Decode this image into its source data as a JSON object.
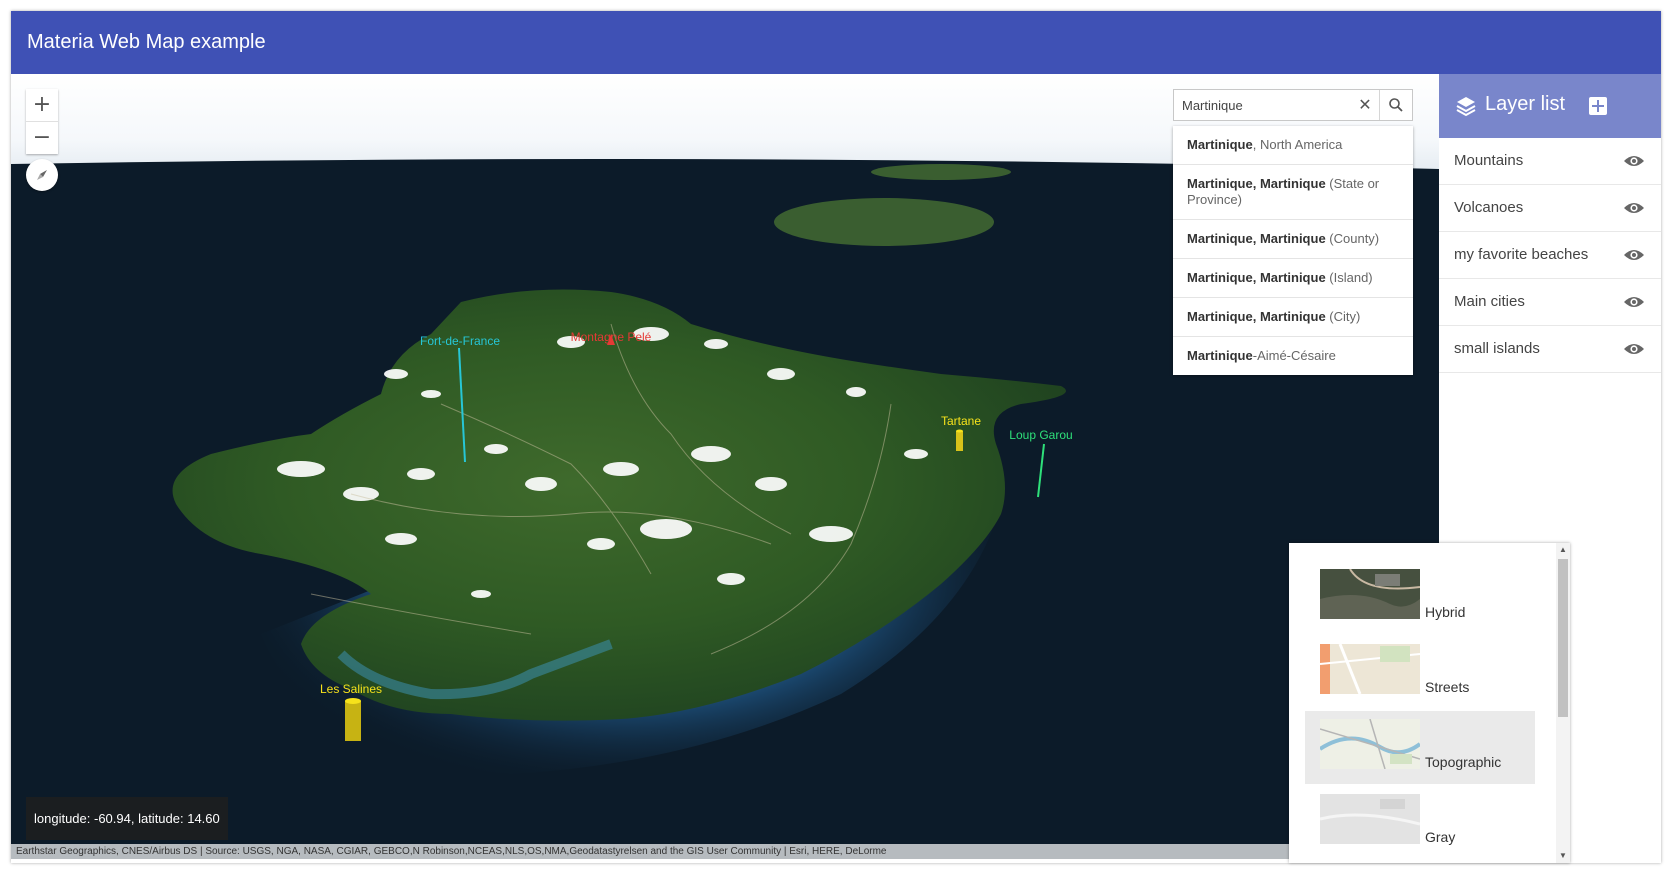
{
  "app": {
    "title": "Materia Web Map example"
  },
  "zoom": {
    "in_label": "+",
    "out_label": "−"
  },
  "search": {
    "value": "Martinique",
    "clear_symbol": "✕",
    "suggestions": [
      {
        "match": "Martinique",
        "rest": ", North America"
      },
      {
        "match": "Martinique, Martinique",
        "rest": " (State or Province)"
      },
      {
        "match": "Martinique, Martinique",
        "rest": " (County)"
      },
      {
        "match": "Martinique, Martinique",
        "rest": " (Island)"
      },
      {
        "match": "Martinique, Martinique",
        "rest": " (City)"
      },
      {
        "match": "Martinique",
        "rest": "-Aimé-Césaire"
      }
    ]
  },
  "map_labels": {
    "fort_de_france": "Fort-de-France",
    "montagne_pele": "Montagne Pelé",
    "tartane": "Tartane",
    "loup_garou": "Loup Garou",
    "les_salines": "Les Salines"
  },
  "coordinates": {
    "text": "longitude: -60.94, latitude: 14.60"
  },
  "attribution": "Earthstar Geographics, CNES/Airbus DS | Source: USGS, NGA, NASA, CGIAR, GEBCO,N Robinson,NCEAS,NLS,OS,NMA,Geodatastyrelsen and the GIS User Community | Esri, HERE, DeLorme",
  "layer_list": {
    "title": "Layer list",
    "layers": [
      {
        "label": "Mountains",
        "icon": "eye-icon"
      },
      {
        "label": "Volcanoes",
        "icon": "eye-icon"
      },
      {
        "label": "my favorite beaches",
        "icon": "eye-icon"
      },
      {
        "label": "Main cities",
        "icon": "eye-icon"
      },
      {
        "label": "small islands",
        "icon": "eye-icon"
      }
    ]
  },
  "basemaps": {
    "items": [
      {
        "label": "Hybrid",
        "selected": false
      },
      {
        "label": "Streets",
        "selected": false
      },
      {
        "label": "Topographic",
        "selected": true
      },
      {
        "label": "Gray",
        "selected": false
      }
    ]
  },
  "colors": {
    "header": "#3f51b5",
    "layer_header": "#7986cb",
    "label_cyan": "#27c6d6",
    "label_red": "#e53935",
    "label_yellow": "#f6e21b",
    "label_green": "#2ee07a"
  }
}
